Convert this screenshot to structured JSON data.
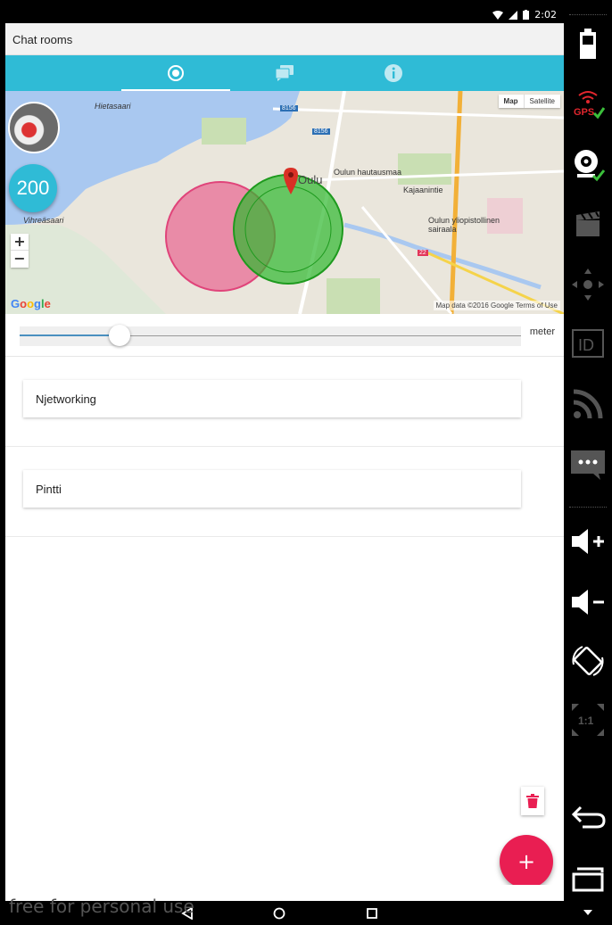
{
  "status_bar": {
    "time": "2:02"
  },
  "title_bar": {
    "title": "Chat rooms"
  },
  "tabs": [
    {
      "name": "radar",
      "icon": "radar-icon",
      "active": true
    },
    {
      "name": "chats",
      "icon": "chat-bubbles-icon",
      "active": false
    },
    {
      "name": "info",
      "icon": "info-icon",
      "active": false
    }
  ],
  "map": {
    "type_buttons": [
      "Map",
      "Satellite"
    ],
    "selected_type": "Map",
    "count_badge": "200",
    "labels": {
      "hietasaari": "Hietasaari",
      "vihreasaari": "Vihreäsaari",
      "oulu": "Oulu",
      "hautausmaa": "Oulun hautausmaa",
      "sairaala": "Oulun yliopistollinen sairaala",
      "kajaanintie": "Kajaanintie",
      "road_8156a": "8156",
      "road_8156b": "8156",
      "road_22": "22"
    },
    "attribution": "Map data ©2016 Google   Terms of Use",
    "google": "Google",
    "zoom_in": "+",
    "zoom_out": "−",
    "colors": {
      "pink_circle": "#e85a8a",
      "green_circle": "#2db82d",
      "marker": "#d93025"
    }
  },
  "slider": {
    "label": "meter",
    "value_fraction": 0.2
  },
  "rooms": [
    {
      "name": "Njetworking"
    },
    {
      "name": "Pintti"
    }
  ],
  "fab": {
    "label": "+"
  },
  "watermark": "free for personal use",
  "accent_color": "#2fbbd6",
  "fab_color": "#e91e52"
}
